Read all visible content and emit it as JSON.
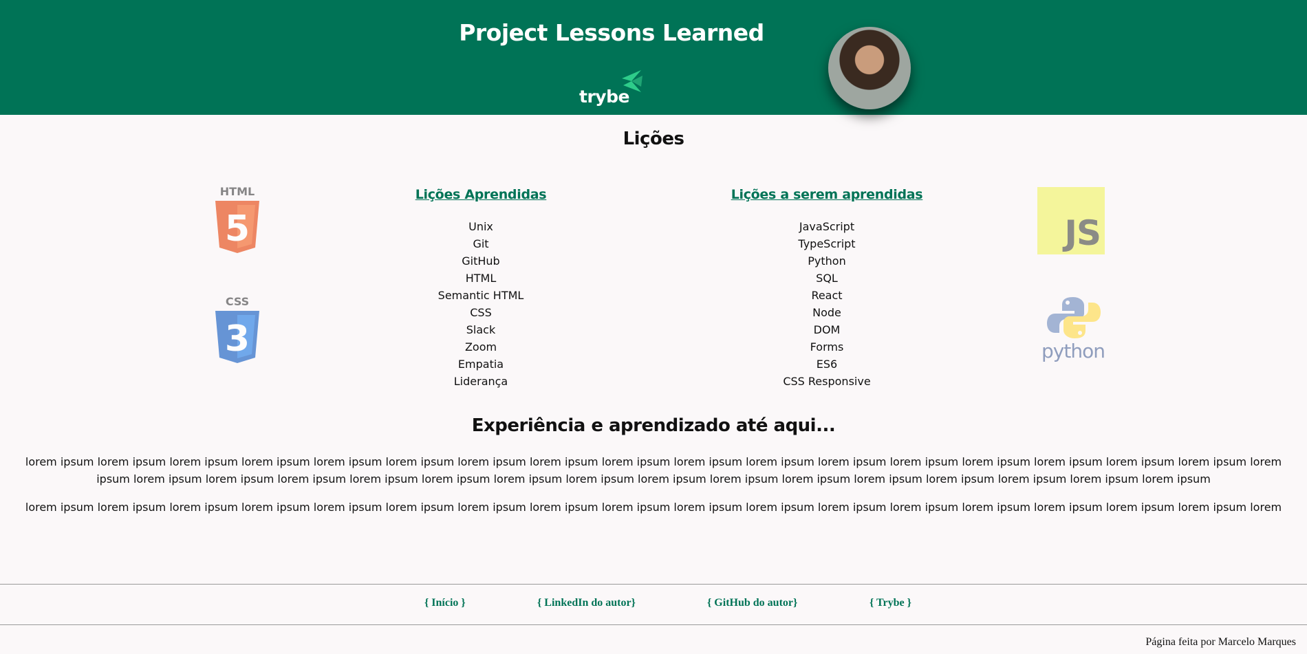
{
  "header": {
    "title": "Project Lessons Learned",
    "logo_text": "trybe",
    "colors": {
      "brand": "#007356",
      "accent": "#2ecc8a"
    },
    "avatar_icon": "author-avatar"
  },
  "lessons": {
    "title": "Lições",
    "learned": {
      "heading": "Lições Aprendidas",
      "items": [
        "Unix",
        "Git",
        "GitHub",
        "HTML",
        "Semantic HTML",
        "CSS",
        "Slack",
        "Zoom",
        "Empatia",
        "Liderança"
      ]
    },
    "to_learn": {
      "heading": "Lições a serem aprendidas",
      "items": [
        "JavaScript",
        "TypeScript",
        "Python",
        "SQL",
        "React",
        "Node",
        "DOM",
        "Forms",
        "ES6",
        "CSS Responsive"
      ]
    },
    "logos": {
      "html_label": "HTML",
      "html_number": "5",
      "css_label": "CSS",
      "css_number": "3",
      "js_label": "JS",
      "python_label": "python"
    }
  },
  "experience": {
    "title": "Experiência e aprendizado até aqui...",
    "paragraphs": [
      "lorem ipsum lorem ipsum lorem ipsum lorem ipsum lorem ipsum lorem ipsum lorem ipsum lorem ipsum lorem ipsum lorem ipsum lorem ipsum lorem ipsum lorem ipsum lorem ipsum lorem ipsum lorem ipsum lorem ipsum lorem ipsum lorem ipsum lorem ipsum lorem ipsum lorem ipsum lorem ipsum lorem ipsum lorem ipsum lorem ipsum lorem ipsum lorem ipsum lorem ipsum lorem ipsum lorem ipsum lorem ipsum lorem ipsum",
      "lorem ipsum lorem ipsum lorem ipsum lorem ipsum lorem ipsum lorem ipsum lorem ipsum lorem ipsum lorem ipsum lorem ipsum lorem ipsum lorem ipsum lorem ipsum lorem ipsum lorem ipsum lorem ipsum lorem ipsum lorem"
    ]
  },
  "footer": {
    "links": [
      "{ Início }",
      "{ LinkedIn do autor}",
      "{ GitHub do autor}",
      "{ Trybe }"
    ],
    "credit": "Página feita por Marcelo Marques"
  }
}
